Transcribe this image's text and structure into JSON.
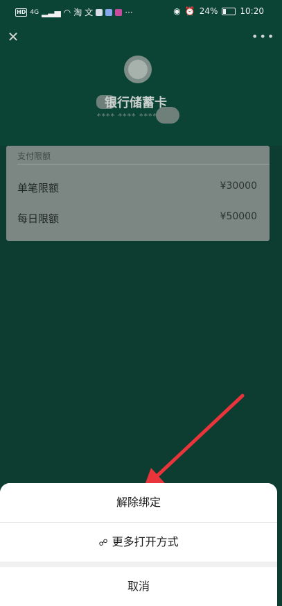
{
  "status_bar": {
    "left_items": [
      "HD",
      "4G",
      "淘",
      "文"
    ],
    "battery": "24%",
    "time": "10:20",
    "battery_level": 0.24
  },
  "header": {
    "close_icon": "close-icon",
    "more_icon": "more-icon"
  },
  "card": {
    "bank_name": "银行储蓄卡",
    "card_number_mask": "**** **** ****"
  },
  "limits": {
    "section_title": "支付限额",
    "rows": [
      {
        "label": "单笔限额",
        "amount": "¥30000"
      },
      {
        "label": "每日限额",
        "amount": "¥50000"
      }
    ]
  },
  "sheet": {
    "unbind": "解除绑定",
    "more_open": "更多打开方式",
    "cancel": "取消"
  },
  "colors": {
    "background": "#0c3d30",
    "sheet": "#ffffff",
    "arrow": "#e8343a"
  }
}
